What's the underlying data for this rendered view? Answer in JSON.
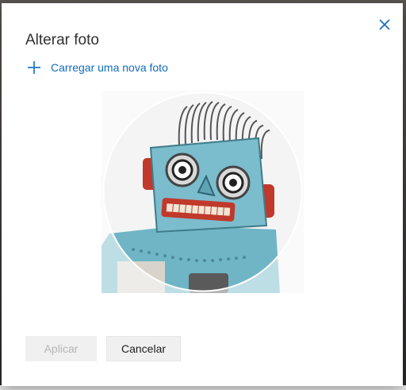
{
  "dialog": {
    "title": "Alterar foto",
    "close_icon": "close-icon"
  },
  "upload": {
    "icon": "plus-icon",
    "label": "Carregar uma nova foto"
  },
  "photo": {
    "description_icon": "robot-image"
  },
  "buttons": {
    "apply_label": "Aplicar",
    "apply_disabled": true,
    "cancel_label": "Cancelar"
  },
  "colors": {
    "accent": "#0f6cbd",
    "text": "#323130",
    "disabled_text": "#b5b5b5",
    "button_bg": "#f0f0f0"
  }
}
